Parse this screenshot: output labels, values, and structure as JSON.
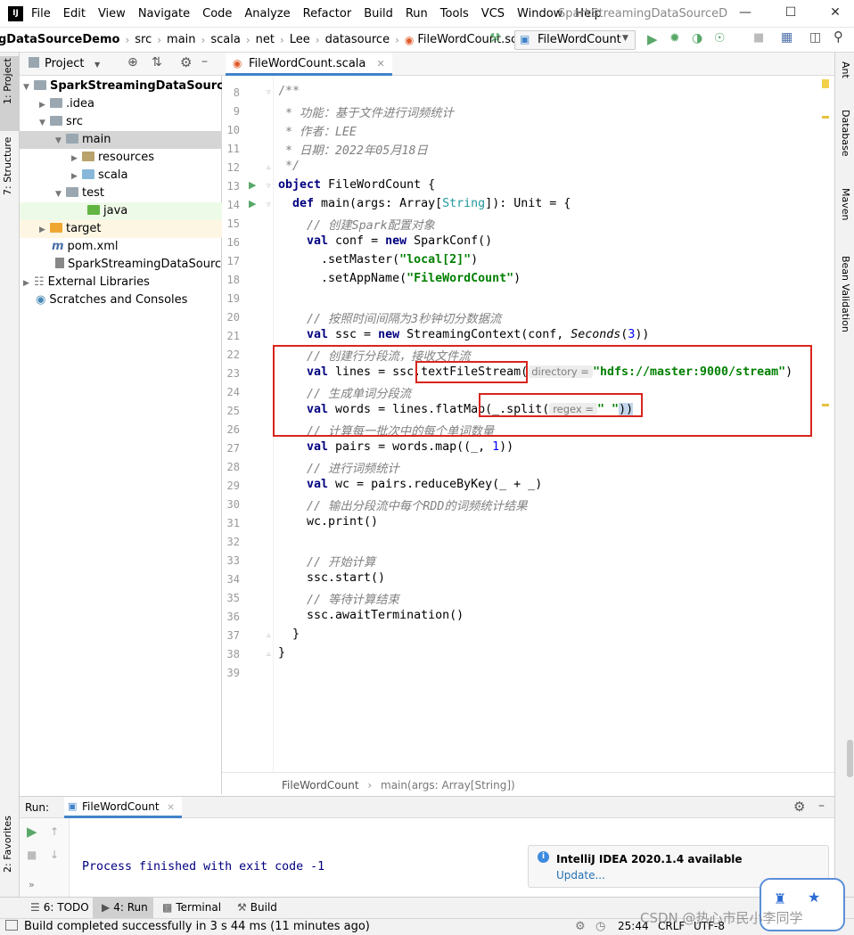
{
  "menu": [
    "File",
    "Edit",
    "View",
    "Navigate",
    "Code",
    "Analyze",
    "Refactor",
    "Build",
    "Run",
    "Tools",
    "VCS",
    "Window",
    "Help"
  ],
  "window_title": "SparkStreamingDataSourceDem",
  "breadcrumbs": [
    "gDataSourceDemo",
    "src",
    "main",
    "scala",
    "net",
    "Lee",
    "datasource",
    "FileWordCount.scala"
  ],
  "run_config": "FileWordCount",
  "left_stripe": {
    "project": "1: Project",
    "structure": "7: Structure",
    "favorites": "2: Favorites"
  },
  "right_stripe": {
    "ant": "Ant",
    "database": "Database",
    "maven": "Maven",
    "bean": "Bean Validation"
  },
  "project_panel": {
    "title": "Project",
    "tree": [
      {
        "label": "SparkStreamingDataSourceDem",
        "bold": true
      },
      {
        "label": ".idea"
      },
      {
        "label": "src"
      },
      {
        "label": "main"
      },
      {
        "label": "resources"
      },
      {
        "label": "scala"
      },
      {
        "label": "test"
      },
      {
        "label": "java"
      },
      {
        "label": "target"
      },
      {
        "label": "pom.xml"
      },
      {
        "label": "SparkStreamingDataSourceD"
      },
      {
        "label": "External Libraries"
      },
      {
        "label": "Scratches and Consoles"
      }
    ]
  },
  "editor": {
    "tab": "FileWordCount.scala",
    "line_numbers": [
      "8",
      "9",
      "10",
      "11",
      "12",
      "13",
      "14",
      "15",
      "16",
      "17",
      "18",
      "19",
      "20",
      "21",
      "22",
      "23",
      "24",
      "25",
      "26",
      "27",
      "28",
      "29",
      "30",
      "31",
      "32",
      "33",
      "34",
      "35",
      "36",
      "37",
      "38",
      "39"
    ],
    "lines": {
      "l8": "/**",
      "l9": " * 功能：基于文件进行词频统计",
      "l10": " * 作者：LEE",
      "l11": " * 日期：2022年05月18日",
      "l12": " */",
      "l13a": "object",
      "l13b": " FileWordCount {",
      "l14a": "def",
      "l14b": " main(args: Array[",
      "l14c": "String",
      "l14d": "]): Unit = {",
      "l15": "// 创建Spark配置对象",
      "l16a": "val",
      "l16b": " conf = ",
      "l16c": "new",
      "l16d": " SparkConf()",
      "l17a": "  .setMaster(",
      "l17b": "\"local[2]\"",
      "l17c": ")",
      "l18a": "  .setAppName(",
      "l18b": "\"FileWordCount\"",
      "l18c": ")",
      "l20": "// 按照时间间隔为3秒钟切分数据流",
      "l21a": "val",
      "l21b": " ssc = ",
      "l21c": "new",
      "l21d": " StreamingContext(conf, ",
      "l21e": "Seconds",
      "l21f": "(",
      "l21g": "3",
      "l21h": "))",
      "l22": "// 创建行分段流，接收文件流",
      "l23a": "val",
      "l23b": " lines = ssc.",
      "l23c": "textFileStream(",
      "l23hint": "directory =",
      "l23d": "\"hdfs://master:9000/stream\"",
      "l23e": ")",
      "l24": "// 生成单词分段流",
      "l25a": "val",
      "l25b": " words = lines.flatMap(",
      "l25c": "_.split(",
      "l25hint": "regex =",
      "l25d": "\" \"",
      "l25e": "))",
      "l26": "// 计算每一批次中的每个单词数量",
      "l27a": "val",
      "l27b": " pairs = words.map((_, ",
      "l27c": "1",
      "l27d": "))",
      "l28": "// 进行词频统计",
      "l29a": "val",
      "l29b": " wc = pairs.reduceByKey(_ + _)",
      "l30": "// 输出分段流中每个RDD的词频统计结果",
      "l31": "wc.print()",
      "l33": "// 开始计算",
      "l34": "ssc.start()",
      "l35": "// 等待计算结束",
      "l36": "ssc.awaitTermination()",
      "l37": "}",
      "l38": "}"
    },
    "footer_crumbs": [
      "FileWordCount",
      "main(args: Array[String])"
    ]
  },
  "run_panel": {
    "label": "Run:",
    "tab": "FileWordCount",
    "output": "Process finished with exit code -1"
  },
  "notification": {
    "title": "IntelliJ IDEA 2020.1.4 available",
    "link": "Update..."
  },
  "bottom_tabs": [
    "6: TODO",
    "4: Run",
    "Terminal",
    "Build"
  ],
  "status": {
    "message": "Build completed successfully in 3 s 44 ms (11 minutes ago)",
    "position": "25:44",
    "line_sep": "CRLF",
    "encoding": "UTF-8"
  },
  "watermark": "CSDN @热心市民小李同学",
  "colors": {
    "accent": "#4083c9",
    "highlight_box": "#d9251d",
    "run_green": "#59a869"
  }
}
